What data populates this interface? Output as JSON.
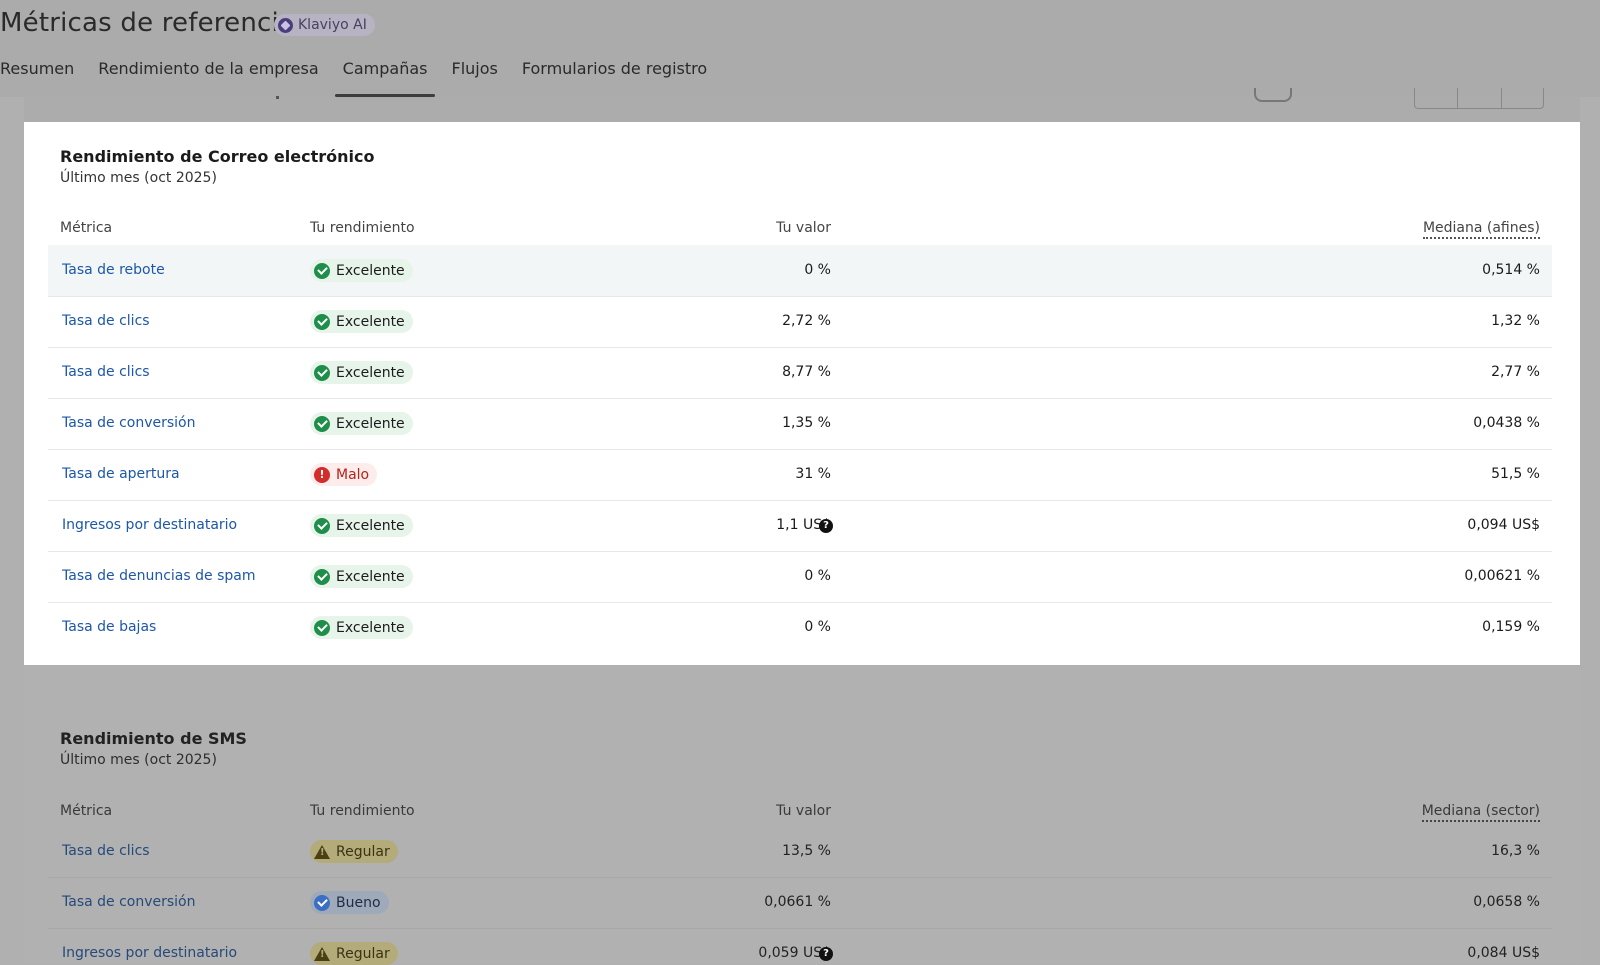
{
  "header": {
    "title": "Métricas de referencia",
    "ai_badge": "Klaviyo AI",
    "tabs": [
      {
        "label": "Resumen",
        "active": false
      },
      {
        "label": "Rendimiento de la empresa",
        "active": false
      },
      {
        "label": "Campañas",
        "active": true
      },
      {
        "label": "Flujos",
        "active": false
      },
      {
        "label": "Formularios de registro",
        "active": false
      }
    ]
  },
  "email_section": {
    "title": "Rendimiento de Correo electrónico",
    "subtitle": "Último mes (oct 2025)",
    "columns": {
      "metric": "Métrica",
      "performance": "Tu rendimiento",
      "value": "Tu valor",
      "median": "Mediana (afines)"
    },
    "rows": [
      {
        "metric": "Tasa de rebote",
        "status": "Excelente",
        "value": "0 %",
        "median": "0,514 %",
        "help": false
      },
      {
        "metric": "Tasa de clics",
        "status": "Excelente",
        "value": "2,72 %",
        "median": "1,32 %",
        "help": false
      },
      {
        "metric": "Tasa de clics",
        "status": "Excelente",
        "value": "8,77 %",
        "median": "2,77 %",
        "help": false
      },
      {
        "metric": "Tasa de conversión",
        "status": "Excelente",
        "value": "1,35 %",
        "median": "0,0438 %",
        "help": false
      },
      {
        "metric": "Tasa de apertura",
        "status": "Malo",
        "value": "31 %",
        "median": "51,5 %",
        "help": false
      },
      {
        "metric": "Ingresos por destinatario",
        "status": "Excelente",
        "value": "1,1 US$",
        "median": "0,094 US$",
        "help": true
      },
      {
        "metric": "Tasa de denuncias de spam",
        "status": "Excelente",
        "value": "0 %",
        "median": "0,00621 %",
        "help": false
      },
      {
        "metric": "Tasa de bajas",
        "status": "Excelente",
        "value": "0 %",
        "median": "0,159 %",
        "help": false
      }
    ]
  },
  "sms_section": {
    "title": "Rendimiento de SMS",
    "subtitle": "Último mes (oct 2025)",
    "columns": {
      "metric": "Métrica",
      "performance": "Tu rendimiento",
      "value": "Tu valor",
      "median": "Mediana (sector)"
    },
    "rows": [
      {
        "metric": "Tasa de clics",
        "status": "Regular",
        "value": "13,5 %",
        "median": "16,3 %"
      },
      {
        "metric": "Tasa de conversión",
        "status": "Bueno",
        "value": "0,0661 %",
        "median": "0,0658 %"
      },
      {
        "metric": "Ingresos por destinatario",
        "status": "Regular",
        "value": "0,059 US$",
        "median": "0,084 US$"
      }
    ]
  },
  "icons": {
    "excellent": "check-circle-icon",
    "bad": "exclamation-circle-icon",
    "regular": "warning-triangle-icon",
    "good": "check-circle-blue-icon",
    "help": "question-circle-icon",
    "ai": "klaviyo-ai-icon"
  },
  "colors": {
    "excellent": "#1e8e4a",
    "bad": "#d42b2b",
    "link": "#1d57a8",
    "overlay": "#b0b0b0"
  }
}
